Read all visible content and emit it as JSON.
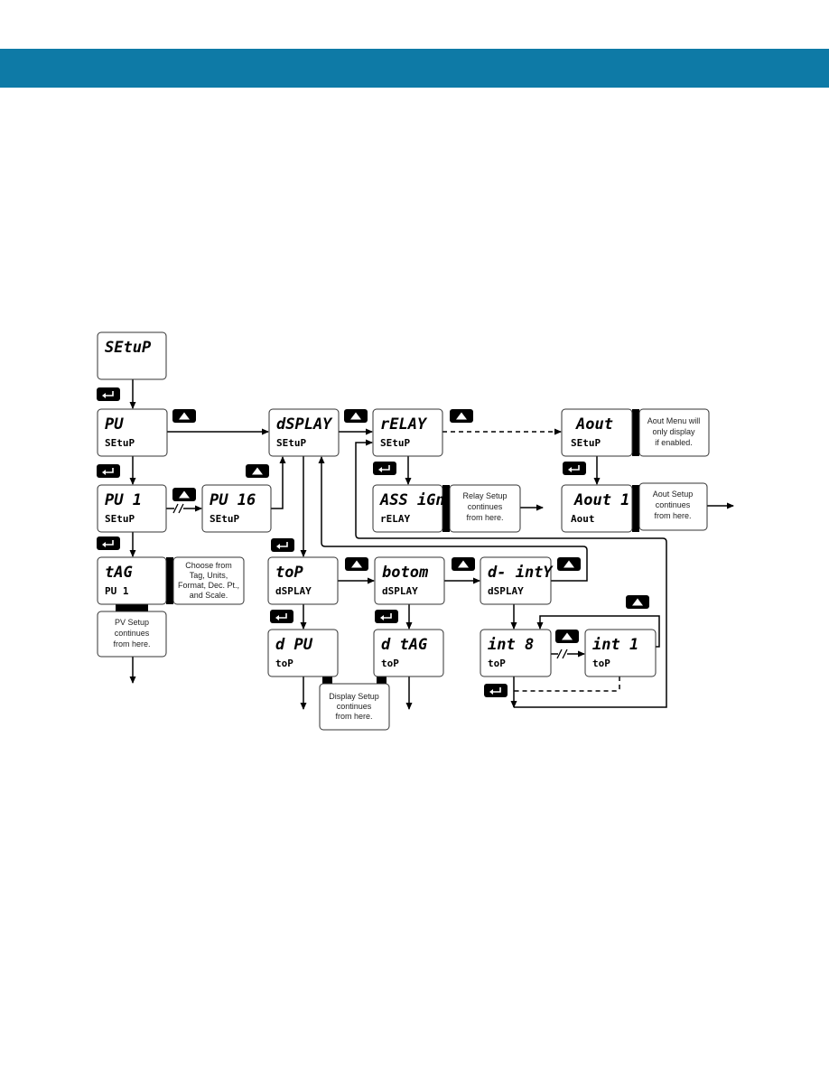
{
  "header": {
    "color": "#0e7aa6"
  },
  "nodes": {
    "setup": {
      "line1": "SEtuP",
      "line2": ""
    },
    "pv_setup": {
      "line1": "PU",
      "line2": "SEtuP"
    },
    "pv1_setup": {
      "line1": "PU  1",
      "line2": "SEtuP"
    },
    "pv16_setup": {
      "line1": "PU  16",
      "line2": "SEtuP"
    },
    "tag_pv1": {
      "line1": "tAG",
      "line2": "PU 1"
    },
    "display_setup": {
      "line1": "dSPLAY",
      "line2": "SEtuP"
    },
    "relay_setup": {
      "line1": "rELAY",
      "line2": "SEtuP"
    },
    "assign_relay": {
      "line1": "ASS iGn",
      "line2": "rELAY"
    },
    "aout_setup": {
      "line1": "Aout",
      "line2": "SEtuP"
    },
    "aout1": {
      "line1": "Aout  1",
      "line2": "Aout"
    },
    "top_display": {
      "line1": "toP",
      "line2": "dSPLAY"
    },
    "bottom_display": {
      "line1": "botom",
      "line2": "dSPLAY"
    },
    "d_inty_display": {
      "line1": "d- intY",
      "line2": "dSPLAY"
    },
    "d_pv_top": {
      "line1": "d PU",
      "line2": "toP"
    },
    "d_tag_top": {
      "line1": "d tAG",
      "line2": "toP"
    },
    "int8_top": {
      "line1": "int 8",
      "line2": "toP"
    },
    "int1_top": {
      "line1": "int  1",
      "line2": "toP"
    }
  },
  "notes": {
    "choose": [
      "Choose from",
      "Tag, Units,",
      "Format, Dec. Pt.,",
      "and Scale."
    ],
    "pv_setup": [
      "PV Setup",
      "continues",
      "from here."
    ],
    "relay_setup": [
      "Relay Setup",
      "continues",
      "from here."
    ],
    "aout_menu": [
      "Aout Menu will",
      "only display",
      "if enabled."
    ],
    "aout_setup": [
      "Aout Setup",
      "continues",
      "from here."
    ],
    "display_setup": [
      "Display Setup",
      "continues",
      "from here."
    ]
  },
  "icons": {
    "up": "up-arrow-button-icon",
    "enter": "enter-button-icon",
    "skip": "skip-break-icon"
  }
}
